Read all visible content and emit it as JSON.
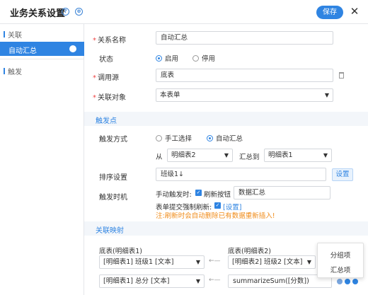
{
  "header": {
    "title": "业务关系设置",
    "help_icon": "question-icon",
    "link_icon": "link-icon",
    "save_label": "保存",
    "close_label": "✕"
  },
  "sidebar": {
    "group1": "关联",
    "active_item": "自动汇总",
    "group2": "触发"
  },
  "form": {
    "name_label": "关系名称",
    "name_value": "自动汇总",
    "status_label": "状态",
    "status_enabled": "启用",
    "status_disabled": "停用",
    "source_label": "调用源",
    "source_value": "底表",
    "target_label": "关联对象",
    "target_value": "本表单"
  },
  "trigger": {
    "section_title": "触发点",
    "mode_label": "触发方式",
    "mode_manual": "手工选择",
    "mode_auto": "自动汇总",
    "from_label": "从",
    "from_value": "明细表2",
    "to_label": "汇总到",
    "to_value": "明细表1",
    "sort_label": "排序设置",
    "sort_value": "班级1↓",
    "sort_button": "设置",
    "timing_label": "触发时机",
    "manual_trigger_label": "手动触发时:",
    "refresh_button_label": "刷新按钮",
    "refresh_button_text": "数据汇总",
    "submit_refresh_label": "表单提交强制刷新:",
    "submit_refresh_link": "[设置]",
    "warning": "注:刷新时会自动删除已有数据重新插入!"
  },
  "mapping": {
    "section_title": "关联映射",
    "left_header": "底表(明细表1)",
    "right_header": "底表(明细表2)",
    "rows": [
      {
        "left": "[明细表1] 班级1 [文本]",
        "right": "[明细表2] 班级2 [文本]"
      },
      {
        "left": "[明细表1] 总分 [文本]",
        "right": "summarizeSum([分数])"
      }
    ]
  },
  "popup": {
    "items": [
      "分组项",
      "汇总项"
    ]
  },
  "colors": {
    "accent": "#2f84e2",
    "warning": "#f08c1a",
    "required": "#e44444"
  }
}
